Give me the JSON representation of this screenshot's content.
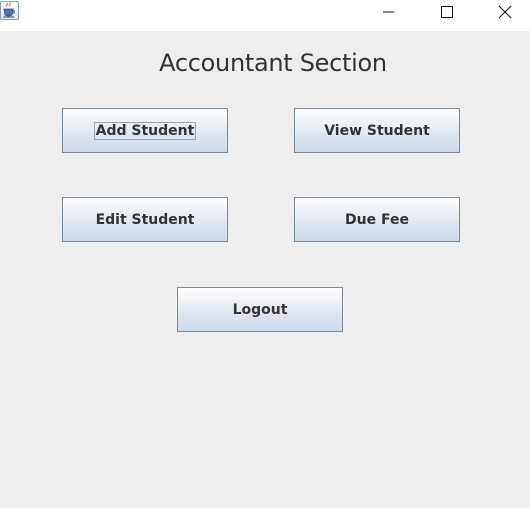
{
  "window": {
    "app_icon": "java-cup-icon",
    "controls": {
      "minimize_icon": "minimize-icon",
      "maximize_icon": "maximize-icon",
      "close_icon": "close-icon"
    }
  },
  "section": {
    "title": "Accountant Section"
  },
  "buttons": {
    "add_student": "Add Student",
    "view_student": "View Student",
    "edit_student": "Edit Student",
    "due_fee": "Due Fee",
    "logout": "Logout"
  },
  "focused_button": "add_student",
  "colors": {
    "window_background": "#eeeeee",
    "titlebar_background": "#ffffff",
    "button_border": "#7a8a99",
    "button_text": "#333333"
  }
}
